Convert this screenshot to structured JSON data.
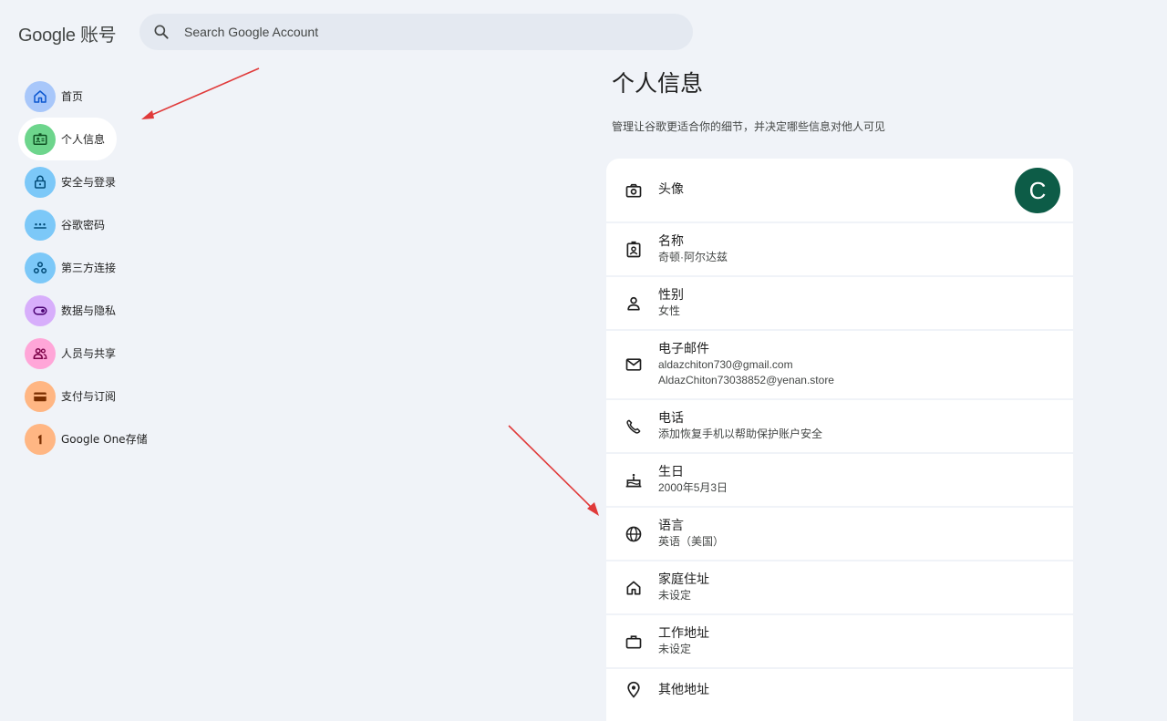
{
  "header": {
    "logo": "Google 账号",
    "search_placeholder": "Search Google Account"
  },
  "sidebar": {
    "items": [
      {
        "label": "首页",
        "icon": "home-icon",
        "color": "#a8c7fa"
      },
      {
        "label": "个人信息",
        "icon": "id-card-icon",
        "color": "#6dd58c"
      },
      {
        "label": "安全与登录",
        "icon": "lock-icon",
        "color": "#7cc8f8"
      },
      {
        "label": "谷歌密码",
        "icon": "password-icon",
        "color": "#7cc8f8"
      },
      {
        "label": "第三方连接",
        "icon": "connections-icon",
        "color": "#7cc8f8"
      },
      {
        "label": "数据与隐私",
        "icon": "toggle-icon",
        "color": "#d7aefb"
      },
      {
        "label": "人员与共享",
        "icon": "people-icon",
        "color": "#ffa6d8"
      },
      {
        "label": "支付与订阅",
        "icon": "wallet-icon",
        "color": "#ffb683"
      },
      {
        "label": "Google One存储",
        "icon": "google-one-icon",
        "color": "#ffb683"
      }
    ]
  },
  "main": {
    "title": "个人信息",
    "subtitle": "管理让谷歌更适合你的细节，并决定哪些信息对他人可见",
    "rows": [
      {
        "label": "头像",
        "icon": "camera-icon",
        "avatar_letter": "C"
      },
      {
        "label": "名称",
        "icon": "badge-icon",
        "values": [
          "奇顿·阿尔达兹"
        ]
      },
      {
        "label": "性别",
        "icon": "person-icon",
        "values": [
          "女性"
        ]
      },
      {
        "label": "电子邮件",
        "icon": "mail-icon",
        "values": [
          "aldazchiton730@gmail.com",
          "AldazChiton73038852@yenan.store"
        ]
      },
      {
        "label": "电话",
        "icon": "phone-icon",
        "values": [
          "添加恢复手机以帮助保护账户安全"
        ]
      },
      {
        "label": "生日",
        "icon": "cake-icon",
        "values": [
          "2000年5月3日"
        ]
      },
      {
        "label": "语言",
        "icon": "globe-icon",
        "values": [
          "英语（美国）"
        ]
      },
      {
        "label": "家庭住址",
        "icon": "home-icon",
        "values": [
          "未设定"
        ]
      },
      {
        "label": "工作地址",
        "icon": "briefcase-icon",
        "values": [
          "未设定"
        ]
      },
      {
        "label": "其他地址",
        "icon": "location-icon",
        "values": []
      }
    ]
  }
}
